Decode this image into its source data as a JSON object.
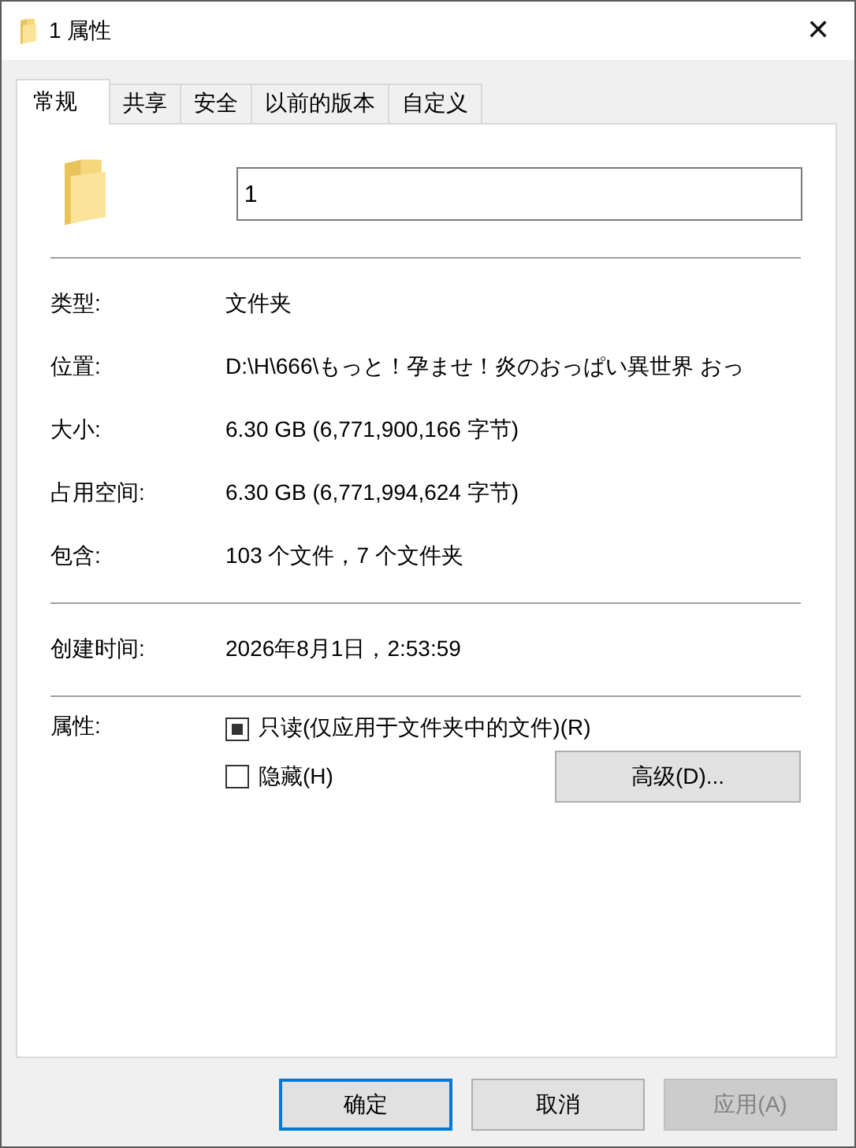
{
  "window": {
    "title": "1 属性",
    "close": "✕"
  },
  "tabs": [
    {
      "label": "常规",
      "selected": true
    },
    {
      "label": "共享",
      "selected": false
    },
    {
      "label": "安全",
      "selected": false
    },
    {
      "label": "以前的版本",
      "selected": false
    },
    {
      "label": "自定义",
      "selected": false
    }
  ],
  "name_field": {
    "value": "1"
  },
  "sections": [
    [
      {
        "label": "类型:",
        "value": "文件夹"
      },
      {
        "label": "位置:",
        "value": "D:\\H\\666\\もっと！孕ませ！炎のおっぱい異世界 おっ"
      },
      {
        "label": "大小:",
        "value": "6.30 GB (6,771,900,166 字节)"
      },
      {
        "label": "占用空间:",
        "value": "6.30 GB (6,771,994,624 字节)"
      },
      {
        "label": "包含:",
        "value": "103 个文件，7 个文件夹"
      }
    ],
    [
      {
        "label": "创建时间:",
        "value": "2026年8月1日，2:53:59"
      }
    ]
  ],
  "attributes": {
    "label": "属性:",
    "checkboxes": [
      {
        "label": "只读(仅应用于文件夹中的文件)(R)",
        "checked": false,
        "indeterminate": true
      },
      {
        "label": "隐藏(H)",
        "checked": false,
        "indeterminate": false
      }
    ],
    "advanced_button": "高级(D)..."
  },
  "buttons": [
    {
      "label": "确定",
      "default": true,
      "disabled": false
    },
    {
      "label": "取消",
      "default": false,
      "disabled": false
    },
    {
      "label": "应用(A)",
      "default": false,
      "disabled": true
    }
  ]
}
